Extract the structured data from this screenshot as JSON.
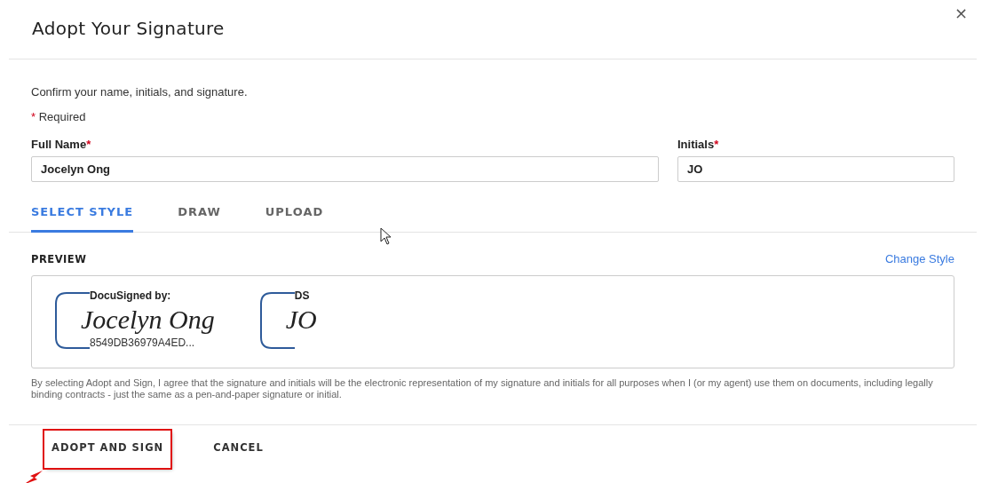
{
  "dialog": {
    "title": "Adopt Your Signature",
    "close": "×"
  },
  "intro": "Confirm your name, initials, and signature.",
  "required_note": {
    "mark": "*",
    "text": "Required"
  },
  "fields": [
    {
      "label": "Full Name",
      "required": true,
      "value": "Jocelyn Ong"
    },
    {
      "label": "Initials",
      "required": true,
      "value": "JO"
    }
  ],
  "tabs": [
    {
      "label": "SELECT STYLE",
      "selected": true
    },
    {
      "label": "DRAW",
      "selected": false
    },
    {
      "label": "UPLOAD",
      "selected": false
    }
  ],
  "preview": {
    "label": "PREVIEW",
    "link": "Change Style",
    "stamps": [
      {
        "header": "DocuSigned by:",
        "signature": "Jocelyn Ong",
        "footer": "8549DB36979A4ED..."
      },
      {
        "header": "DS",
        "signature": "JO"
      }
    ]
  },
  "legal": "By selecting Adopt and Sign, I agree that the signature and initials will be the electronic representation of my signature and initials for all purposes when I (or my agent) use them on documents, including legally binding contracts - just the same as a pen-and-paper signature or initial.",
  "buttons": [
    {
      "label": "ADOPT AND SIGN",
      "highlighted": true
    },
    {
      "label": "CANCEL",
      "highlighted": false
    }
  ]
}
